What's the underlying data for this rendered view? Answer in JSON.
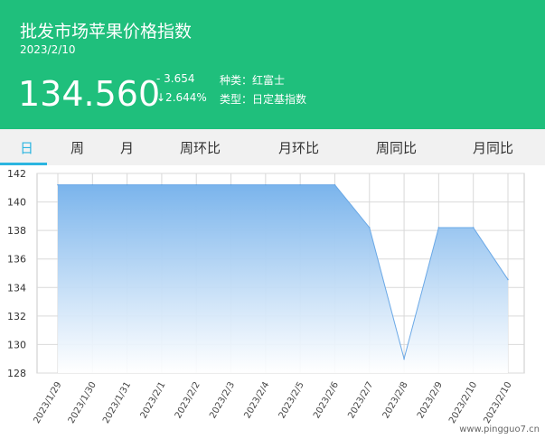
{
  "header": {
    "title": "批发市场苹果价格指数",
    "date": "2023/2/10",
    "price": "134.560",
    "change": "- 3.654",
    "change_pct": "↓2.644%",
    "kind": "种类：红富士",
    "type": "类型：日定基指数"
  },
  "tabs": [
    "日",
    "周",
    "月",
    "周环比",
    "月环比",
    "周同比",
    "月同比"
  ],
  "active_tab": 0,
  "watermark": "www.pingguo7.cn",
  "colors": {
    "header_bg": "#1fbf7c",
    "accent": "#2bb5e0",
    "area_top": "#7ab4ec",
    "line": "#6aa8e6"
  },
  "chart_data": {
    "type": "area",
    "title": "",
    "xlabel": "",
    "ylabel": "",
    "x": [
      "2023/1/29",
      "2023/1/30",
      "2023/1/31",
      "2023/2/1",
      "2023/2/2",
      "2023/2/3",
      "2023/2/4",
      "2023/2/5",
      "2023/2/6",
      "2023/2/7",
      "2023/2/8",
      "2023/2/9",
      "2023/2/10",
      "2023/2/10"
    ],
    "values": [
      141.2,
      141.2,
      141.2,
      141.2,
      141.2,
      141.2,
      141.2,
      141.2,
      141.2,
      138.2,
      129.0,
      138.2,
      138.2,
      134.56
    ],
    "ylim": [
      128,
      142
    ],
    "yticks": [
      128,
      130,
      132,
      134,
      136,
      138,
      140,
      142
    ],
    "grid": true
  }
}
